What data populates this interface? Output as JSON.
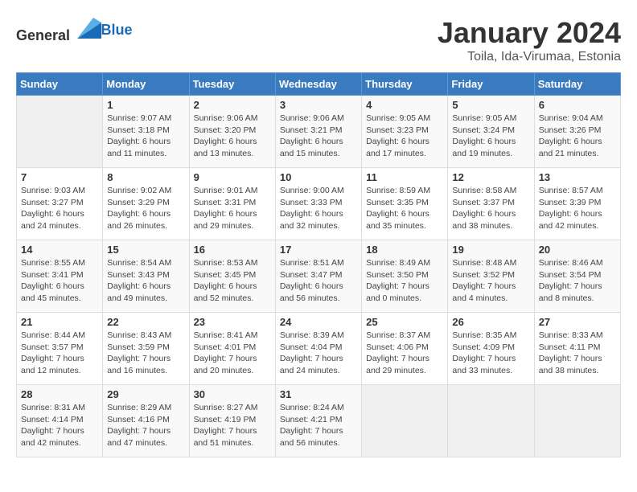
{
  "header": {
    "logo_general": "General",
    "logo_blue": "Blue",
    "month": "January 2024",
    "location": "Toila, Ida-Virumaa, Estonia"
  },
  "weekdays": [
    "Sunday",
    "Monday",
    "Tuesday",
    "Wednesday",
    "Thursday",
    "Friday",
    "Saturday"
  ],
  "weeks": [
    [
      {
        "day": "",
        "info": ""
      },
      {
        "day": "1",
        "info": "Sunrise: 9:07 AM\nSunset: 3:18 PM\nDaylight: 6 hours\nand 11 minutes."
      },
      {
        "day": "2",
        "info": "Sunrise: 9:06 AM\nSunset: 3:20 PM\nDaylight: 6 hours\nand 13 minutes."
      },
      {
        "day": "3",
        "info": "Sunrise: 9:06 AM\nSunset: 3:21 PM\nDaylight: 6 hours\nand 15 minutes."
      },
      {
        "day": "4",
        "info": "Sunrise: 9:05 AM\nSunset: 3:23 PM\nDaylight: 6 hours\nand 17 minutes."
      },
      {
        "day": "5",
        "info": "Sunrise: 9:05 AM\nSunset: 3:24 PM\nDaylight: 6 hours\nand 19 minutes."
      },
      {
        "day": "6",
        "info": "Sunrise: 9:04 AM\nSunset: 3:26 PM\nDaylight: 6 hours\nand 21 minutes."
      }
    ],
    [
      {
        "day": "7",
        "info": "Sunrise: 9:03 AM\nSunset: 3:27 PM\nDaylight: 6 hours\nand 24 minutes."
      },
      {
        "day": "8",
        "info": "Sunrise: 9:02 AM\nSunset: 3:29 PM\nDaylight: 6 hours\nand 26 minutes."
      },
      {
        "day": "9",
        "info": "Sunrise: 9:01 AM\nSunset: 3:31 PM\nDaylight: 6 hours\nand 29 minutes."
      },
      {
        "day": "10",
        "info": "Sunrise: 9:00 AM\nSunset: 3:33 PM\nDaylight: 6 hours\nand 32 minutes."
      },
      {
        "day": "11",
        "info": "Sunrise: 8:59 AM\nSunset: 3:35 PM\nDaylight: 6 hours\nand 35 minutes."
      },
      {
        "day": "12",
        "info": "Sunrise: 8:58 AM\nSunset: 3:37 PM\nDaylight: 6 hours\nand 38 minutes."
      },
      {
        "day": "13",
        "info": "Sunrise: 8:57 AM\nSunset: 3:39 PM\nDaylight: 6 hours\nand 42 minutes."
      }
    ],
    [
      {
        "day": "14",
        "info": "Sunrise: 8:55 AM\nSunset: 3:41 PM\nDaylight: 6 hours\nand 45 minutes."
      },
      {
        "day": "15",
        "info": "Sunrise: 8:54 AM\nSunset: 3:43 PM\nDaylight: 6 hours\nand 49 minutes."
      },
      {
        "day": "16",
        "info": "Sunrise: 8:53 AM\nSunset: 3:45 PM\nDaylight: 6 hours\nand 52 minutes."
      },
      {
        "day": "17",
        "info": "Sunrise: 8:51 AM\nSunset: 3:47 PM\nDaylight: 6 hours\nand 56 minutes."
      },
      {
        "day": "18",
        "info": "Sunrise: 8:49 AM\nSunset: 3:50 PM\nDaylight: 7 hours\nand 0 minutes."
      },
      {
        "day": "19",
        "info": "Sunrise: 8:48 AM\nSunset: 3:52 PM\nDaylight: 7 hours\nand 4 minutes."
      },
      {
        "day": "20",
        "info": "Sunrise: 8:46 AM\nSunset: 3:54 PM\nDaylight: 7 hours\nand 8 minutes."
      }
    ],
    [
      {
        "day": "21",
        "info": "Sunrise: 8:44 AM\nSunset: 3:57 PM\nDaylight: 7 hours\nand 12 minutes."
      },
      {
        "day": "22",
        "info": "Sunrise: 8:43 AM\nSunset: 3:59 PM\nDaylight: 7 hours\nand 16 minutes."
      },
      {
        "day": "23",
        "info": "Sunrise: 8:41 AM\nSunset: 4:01 PM\nDaylight: 7 hours\nand 20 minutes."
      },
      {
        "day": "24",
        "info": "Sunrise: 8:39 AM\nSunset: 4:04 PM\nDaylight: 7 hours\nand 24 minutes."
      },
      {
        "day": "25",
        "info": "Sunrise: 8:37 AM\nSunset: 4:06 PM\nDaylight: 7 hours\nand 29 minutes."
      },
      {
        "day": "26",
        "info": "Sunrise: 8:35 AM\nSunset: 4:09 PM\nDaylight: 7 hours\nand 33 minutes."
      },
      {
        "day": "27",
        "info": "Sunrise: 8:33 AM\nSunset: 4:11 PM\nDaylight: 7 hours\nand 38 minutes."
      }
    ],
    [
      {
        "day": "28",
        "info": "Sunrise: 8:31 AM\nSunset: 4:14 PM\nDaylight: 7 hours\nand 42 minutes."
      },
      {
        "day": "29",
        "info": "Sunrise: 8:29 AM\nSunset: 4:16 PM\nDaylight: 7 hours\nand 47 minutes."
      },
      {
        "day": "30",
        "info": "Sunrise: 8:27 AM\nSunset: 4:19 PM\nDaylight: 7 hours\nand 51 minutes."
      },
      {
        "day": "31",
        "info": "Sunrise: 8:24 AM\nSunset: 4:21 PM\nDaylight: 7 hours\nand 56 minutes."
      },
      {
        "day": "",
        "info": ""
      },
      {
        "day": "",
        "info": ""
      },
      {
        "day": "",
        "info": ""
      }
    ]
  ]
}
